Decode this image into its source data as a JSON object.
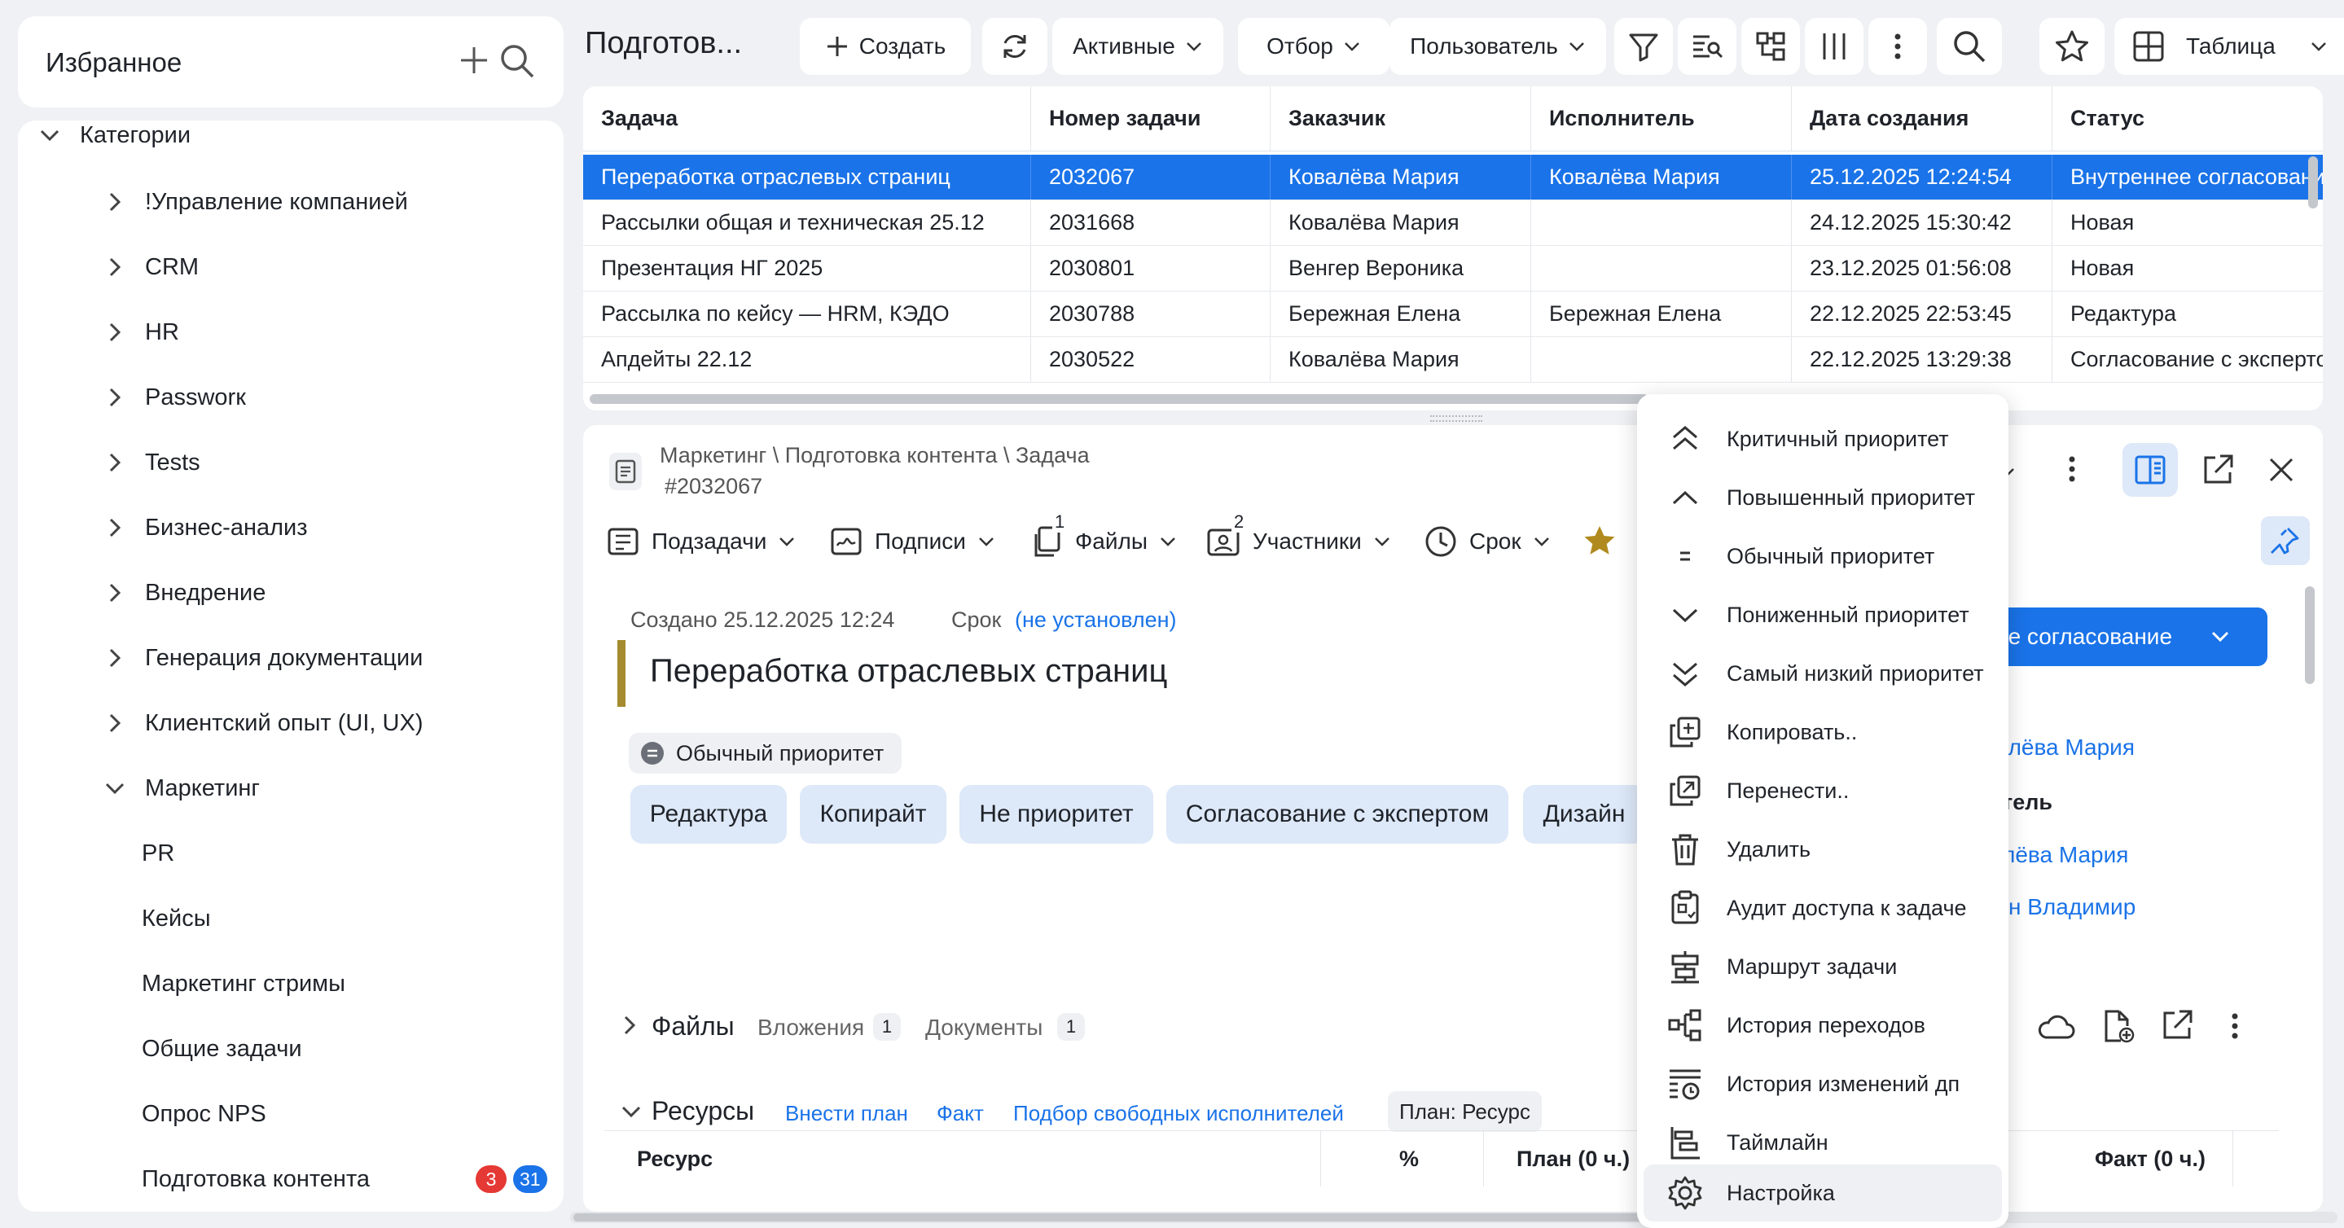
{
  "sidebar": {
    "title": "Избранное",
    "root": "Категории",
    "items": [
      {
        "label": "!Управление компанией"
      },
      {
        "label": "CRM"
      },
      {
        "label": "HR"
      },
      {
        "label": "Passworк"
      },
      {
        "label": "Tests"
      },
      {
        "label": "Бизнес-анализ"
      },
      {
        "label": "Внедрение"
      },
      {
        "label": "Генерация документации"
      },
      {
        "label": "Клиентский опыт (UI, UX)"
      },
      {
        "label": "Маркетинг"
      }
    ],
    "subitems": [
      {
        "label": "PR"
      },
      {
        "label": "Кейсы"
      },
      {
        "label": "Маркетинг стримы"
      },
      {
        "label": "Общие задачи"
      },
      {
        "label": "Опрос NPS"
      },
      {
        "label": "Подготовка контента",
        "badge_red": "3",
        "badge_blue": "31"
      }
    ]
  },
  "toolbar": {
    "title": "Подготов...",
    "create": "Создать",
    "active": "Активные",
    "filter": "Отбор",
    "user": "Пользователь",
    "view": "Таблица"
  },
  "table": {
    "columns": [
      "Задача",
      "Номер задачи",
      "Заказчик",
      "Исполнитель",
      "Дата создания",
      "Статус"
    ],
    "rows": [
      [
        "Переработка отраслевых страниц",
        "2032067",
        "Ковалёва Мария",
        "Ковалёва Мария",
        "25.12.2025 12:24:54",
        "Внутреннее согласование"
      ],
      [
        "Рассылки общая и техническая 25.12",
        "2031668",
        "Ковалёва Мария",
        "",
        "24.12.2025 15:30:42",
        "Новая"
      ],
      [
        "Презентация НГ 2025",
        "2030801",
        "Венгер Вероника",
        "",
        "23.12.2025 01:56:08",
        "Новая"
      ],
      [
        "Рассылка по кейсу — HRM, КЭДО",
        "2030788",
        "Бережная Елена",
        "Бережная Елена",
        "22.12.2025 22:53:45",
        "Редактура"
      ],
      [
        "Апдейты 22.12",
        "2030522",
        "Ковалёва Мария",
        "",
        "22.12.2025 13:29:38",
        "Согласование с экспертом"
      ]
    ]
  },
  "detail": {
    "breadcrumb": "Маркетинг \\ Подготовка контента \\ Задача",
    "number": "#2032067",
    "tabs": {
      "subtasks": "Подзадачи",
      "signatures": "Подписи",
      "files": "Файлы",
      "files_count": "1",
      "participants": "Участники",
      "participants_count": "2",
      "deadline": "Срок"
    },
    "created": "Создано 25.12.2025 12:24",
    "deadline_label": "Срок",
    "deadline_value": "(не установлен)",
    "title": "Переработка отраслевых страниц",
    "priority": "Обычный приоритет",
    "tags": [
      "Редактура",
      "Копирайт",
      "Не приоритет",
      "Согласование с экспертом",
      "Дизайн"
    ],
    "status_button": "ее согласование",
    "side": {
      "customer": "алёва Мария",
      "executor_label": "тель",
      "executor": "лёва Мария",
      "other": "н Владимир"
    },
    "files": {
      "title": "Файлы",
      "attachments": "Вложения",
      "attachments_count": "1",
      "documents": "Документы",
      "documents_count": "1"
    },
    "resources": {
      "title": "Ресурсы",
      "plan_link": "Внести план",
      "fact_link": "Факт",
      "pick_link": "Подбор свободных исполнителей",
      "plan_chip": "План: Ресурс",
      "columns": {
        "resource": "Ресурс",
        "percent": "%",
        "plan": "План (0 ч.)",
        "fact": "Факт (0 ч.)"
      }
    }
  },
  "menu": {
    "items": [
      {
        "label": "Критичный приоритет",
        "icon": "double-chevron-up-icon"
      },
      {
        "label": "Повышенный приоритет",
        "icon": "chevron-up-icon"
      },
      {
        "label": "Обычный приоритет",
        "icon": "equals-icon"
      },
      {
        "label": "Пониженный приоритет",
        "icon": "chevron-down-icon"
      },
      {
        "label": "Самый низкий приоритет",
        "icon": "double-chevron-down-icon"
      },
      {
        "label": "Копировать..",
        "icon": "copy-icon"
      },
      {
        "label": "Перенести..",
        "icon": "move-icon"
      },
      {
        "label": "Удалить",
        "icon": "trash-icon"
      },
      {
        "label": "Аудит доступа к задаче",
        "icon": "audit-icon"
      },
      {
        "label": "Маршрут задачи",
        "icon": "route-icon"
      },
      {
        "label": "История переходов",
        "icon": "transitions-icon"
      },
      {
        "label": "История изменений дп",
        "icon": "history-icon"
      },
      {
        "label": "Таймлайн",
        "icon": "timeline-icon"
      },
      {
        "label": "Настройка",
        "icon": "gear-icon"
      }
    ]
  },
  "colors": {
    "accent": "#1a73e8",
    "badge_red": "#e53935",
    "title_bar": "#a58b2f",
    "star": "#b08a1e"
  }
}
